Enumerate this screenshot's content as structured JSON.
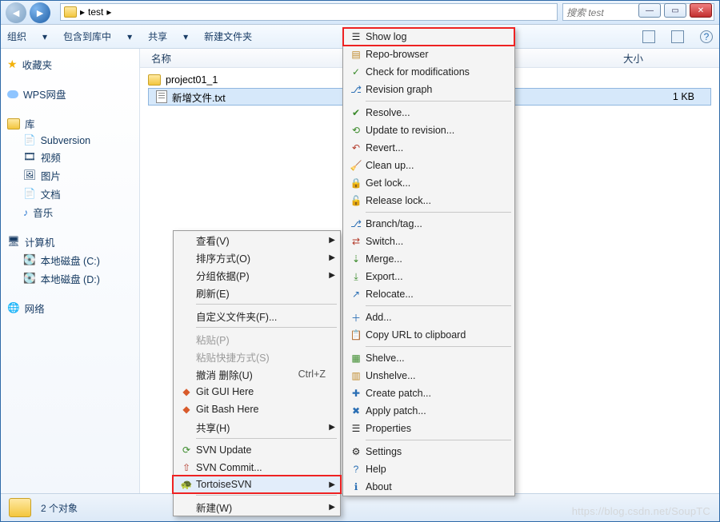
{
  "breadcrumb": {
    "folder": "test"
  },
  "search": {
    "placeholder": "搜索 test"
  },
  "toolbar": {
    "org": "组织",
    "include": "包含到库中",
    "share": "共享",
    "newfolder": "新建文件夹"
  },
  "columns": {
    "name": "名称",
    "size": "大小"
  },
  "files": [
    {
      "name": "project01_1",
      "size": ""
    },
    {
      "name": "新增文件.txt",
      "size": "1 KB"
    }
  ],
  "sidebar": {
    "fav": "收藏夹",
    "wps": "WPS网盘",
    "lib": "库",
    "sub": "Subversion",
    "video": "视频",
    "pic": "图片",
    "doc": "文档",
    "music": "音乐",
    "computer": "计算机",
    "diskC": "本地磁盘 (C:)",
    "diskD": "本地磁盘 (D:)",
    "net": "网络"
  },
  "statusbar": {
    "count": "2 个对象"
  },
  "ctx1": {
    "view": "查看(V)",
    "sort": "排序方式(O)",
    "group": "分组依据(P)",
    "refresh": "刷新(E)",
    "custom": "自定义文件夹(F)...",
    "paste": "粘贴(P)",
    "pasteShortcut": "粘贴快捷方式(S)",
    "undo": "撤消 删除(U)",
    "undoAccel": "Ctrl+Z",
    "gitgui": "Git GUI Here",
    "gitbash": "Git Bash Here",
    "shareH": "共享(H)",
    "svnup": "SVN Update",
    "svncommit": "SVN Commit...",
    "tortoise": "TortoiseSVN",
    "new": "新建(W)"
  },
  "ctx2": {
    "showlog": "Show log",
    "repo": "Repo-browser",
    "checkmods": "Check for modifications",
    "revgraph": "Revision graph",
    "resolve": "Resolve...",
    "updrev": "Update to revision...",
    "revert": "Revert...",
    "cleanup": "Clean up...",
    "getlock": "Get lock...",
    "rellock": "Release lock...",
    "branch": "Branch/tag...",
    "switch": "Switch...",
    "merge": "Merge...",
    "export": "Export...",
    "relocate": "Relocate...",
    "add": "Add...",
    "copyurl": "Copy URL to clipboard",
    "shelve": "Shelve...",
    "unshelve": "Unshelve...",
    "createpatch": "Create patch...",
    "applypatch": "Apply patch...",
    "props": "Properties",
    "settings": "Settings",
    "help": "Help",
    "about": "About"
  },
  "watermark": "https://blog.csdn.net/SoupTC"
}
